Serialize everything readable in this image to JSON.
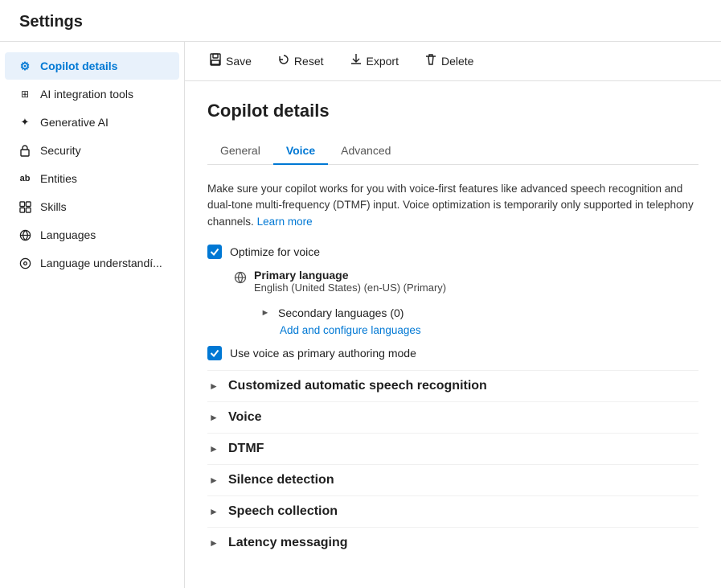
{
  "header": {
    "title": "Settings"
  },
  "sidebar": {
    "items": [
      {
        "id": "copilot-details",
        "label": "Copilot details",
        "icon": "⚙",
        "active": true
      },
      {
        "id": "ai-integration-tools",
        "label": "AI integration tools",
        "icon": "🔗",
        "active": false
      },
      {
        "id": "generative-ai",
        "label": "Generative AI",
        "icon": "✦",
        "active": false
      },
      {
        "id": "security",
        "label": "Security",
        "icon": "🔒",
        "active": false
      },
      {
        "id": "entities",
        "label": "Entities",
        "icon": "ab",
        "active": false
      },
      {
        "id": "skills",
        "label": "Skills",
        "icon": "🗂",
        "active": false
      },
      {
        "id": "languages",
        "label": "Languages",
        "icon": "⚗",
        "active": false
      },
      {
        "id": "language-understanding",
        "label": "Language understandí...",
        "icon": "⚙",
        "active": false
      }
    ]
  },
  "toolbar": {
    "save_label": "Save",
    "reset_label": "Reset",
    "export_label": "Export",
    "delete_label": "Delete"
  },
  "page": {
    "title": "Copilot details",
    "tabs": [
      {
        "id": "general",
        "label": "General",
        "active": false
      },
      {
        "id": "voice",
        "label": "Voice",
        "active": true
      },
      {
        "id": "advanced",
        "label": "Advanced",
        "active": false
      }
    ],
    "description": "Make sure your copilot works for you with voice-first features like advanced speech recognition and dual-tone multi-frequency (DTMF) input. Voice optimization is temporarily only supported in telephony channels.",
    "learn_more": "Learn more",
    "optimize_voice_label": "Optimize for voice",
    "primary_language_label": "Primary language",
    "primary_language_value": "English (United States) (en-US) (Primary)",
    "secondary_languages_label": "Secondary languages (0)",
    "add_configure_label": "Add and configure languages",
    "use_voice_label": "Use voice as primary authoring mode",
    "sections": [
      {
        "id": "custom-asr",
        "label": "Customized automatic speech recognition"
      },
      {
        "id": "voice",
        "label": "Voice"
      },
      {
        "id": "dtmf",
        "label": "DTMF"
      },
      {
        "id": "silence-detection",
        "label": "Silence detection"
      },
      {
        "id": "speech-collection",
        "label": "Speech collection"
      },
      {
        "id": "latency-messaging",
        "label": "Latency messaging"
      }
    ]
  }
}
